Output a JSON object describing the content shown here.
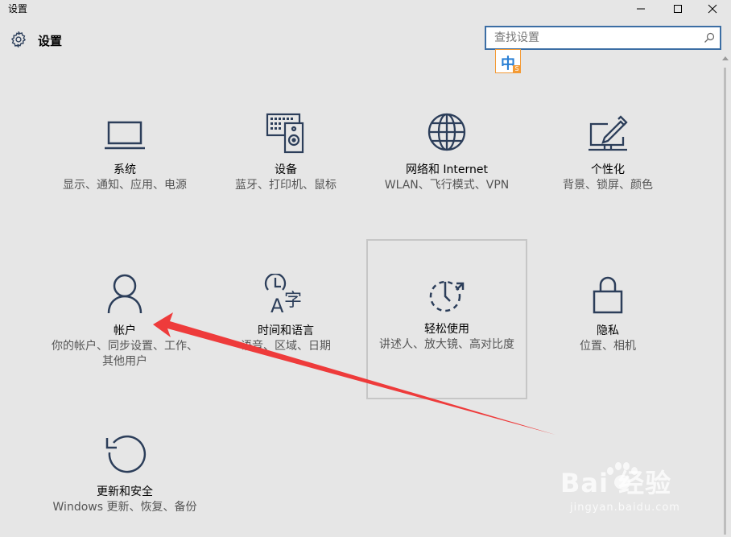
{
  "window": {
    "title": "设置",
    "minimize_glyph": "—",
    "close_glyph": "✕"
  },
  "header": {
    "title": "设置",
    "icon": "gear-icon"
  },
  "search": {
    "placeholder": "查找设置",
    "value": "",
    "icon": "search-icon"
  },
  "ime": {
    "char": "中",
    "badge": "S"
  },
  "tiles": [
    {
      "name": "系统",
      "desc": "显示、通知、应用、电源",
      "icon": "laptop-icon"
    },
    {
      "name": "设备",
      "desc": "蓝牙、打印机、鼠标",
      "icon": "devices-icon"
    },
    {
      "name": "网络和 Internet",
      "desc": "WLAN、飞行模式、VPN",
      "icon": "globe-icon"
    },
    {
      "name": "个性化",
      "desc": "背景、锁屏、颜色",
      "icon": "personalize-icon"
    },
    {
      "name": "帐户",
      "desc": "你的帐户、同步设置、工作、其他用户",
      "icon": "person-icon"
    },
    {
      "name": "时间和语言",
      "desc": "语音、区域、日期",
      "icon": "time-language-icon"
    },
    {
      "name": "轻松使用",
      "desc": "讲述人、放大镜、高对比度",
      "icon": "ease-of-access-icon"
    },
    {
      "name": "隐私",
      "desc": "位置、相机",
      "icon": "lock-icon"
    },
    {
      "name": "更新和安全",
      "desc": "Windows 更新、恢复、备份",
      "icon": "refresh-icon"
    }
  ],
  "watermark": {
    "main": "Bai 经验",
    "sub": "jingyan.baidu.com"
  },
  "colors": {
    "icon": "#2c3e5a",
    "accent": "#3c6ea4",
    "annotation_arrow": "#ee3b3b",
    "background": "#e6e6e6"
  }
}
